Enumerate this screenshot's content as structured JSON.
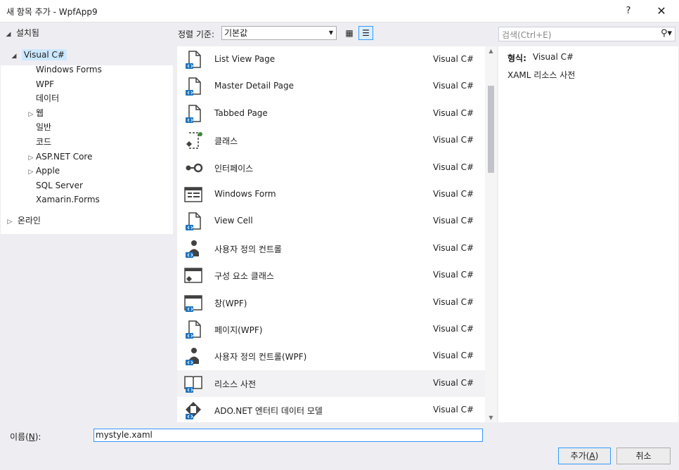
{
  "window": {
    "title": "새 항목 추가 - WpfApp9",
    "help": "?",
    "close": "✕"
  },
  "tree": {
    "installed": "설치됨",
    "root": "Visual C#",
    "children": [
      {
        "label": "Windows Forms",
        "expandable": false
      },
      {
        "label": "WPF",
        "expandable": false
      },
      {
        "label": "데이터",
        "expandable": false
      },
      {
        "label": "웹",
        "expandable": true
      },
      {
        "label": "일반",
        "expandable": false
      },
      {
        "label": "코드",
        "expandable": false
      },
      {
        "label": "ASP.NET Core",
        "expandable": true
      },
      {
        "label": "Apple",
        "expandable": true
      },
      {
        "label": "SQL Server",
        "expandable": false
      },
      {
        "label": "Xamarin.Forms",
        "expandable": false
      }
    ],
    "online": "온라인"
  },
  "sort": {
    "label": "정렬 기준:",
    "value": "기본값"
  },
  "search": {
    "placeholder": "검색(Ctrl+E)"
  },
  "items": [
    {
      "name": "List View Page",
      "lang": "Visual C#",
      "icon": "page-icon"
    },
    {
      "name": "Master Detail Page",
      "lang": "Visual C#",
      "icon": "page-icon"
    },
    {
      "name": "Tabbed Page",
      "lang": "Visual C#",
      "icon": "page-icon"
    },
    {
      "name": "클래스",
      "lang": "Visual C#",
      "icon": "class-icon"
    },
    {
      "name": "인터페이스",
      "lang": "Visual C#",
      "icon": "interface-icon"
    },
    {
      "name": "Windows Form",
      "lang": "Visual C#",
      "icon": "form-icon"
    },
    {
      "name": "View Cell",
      "lang": "Visual C#",
      "icon": "page-icon"
    },
    {
      "name": "사용자 정의 컨트롤",
      "lang": "Visual C#",
      "icon": "user-control-icon"
    },
    {
      "name": "구성 요소 클래스",
      "lang": "Visual C#",
      "icon": "component-icon"
    },
    {
      "name": "창(WPF)",
      "lang": "Visual C#",
      "icon": "window-icon"
    },
    {
      "name": "페이지(WPF)",
      "lang": "Visual C#",
      "icon": "page-icon"
    },
    {
      "name": "사용자 정의 컨트롤(WPF)",
      "lang": "Visual C#",
      "icon": "user-control-icon"
    },
    {
      "name": "리소스 사전",
      "lang": "Visual C#",
      "icon": "dictionary-icon"
    },
    {
      "name": "ADO.NET 엔터티 데이터 모델",
      "lang": "Visual C#",
      "icon": "entity-model-icon"
    }
  ],
  "selected_index": 12,
  "details": {
    "type_label": "형식:",
    "type_value": "Visual C#",
    "description": "XAML 리소스 사전"
  },
  "bottom": {
    "name_label_pre": "이름(",
    "name_label_key": "N",
    "name_label_post": "):",
    "name_value": "mystyle.xaml"
  },
  "buttons": {
    "add_pre": "추가(",
    "add_key": "A",
    "add_post": ")",
    "cancel": "취소"
  },
  "colors": {
    "selection": "#cce8ff",
    "accent": "#3399ff",
    "icon_blue": "#1e73be",
    "icon_dark": "#424242"
  }
}
